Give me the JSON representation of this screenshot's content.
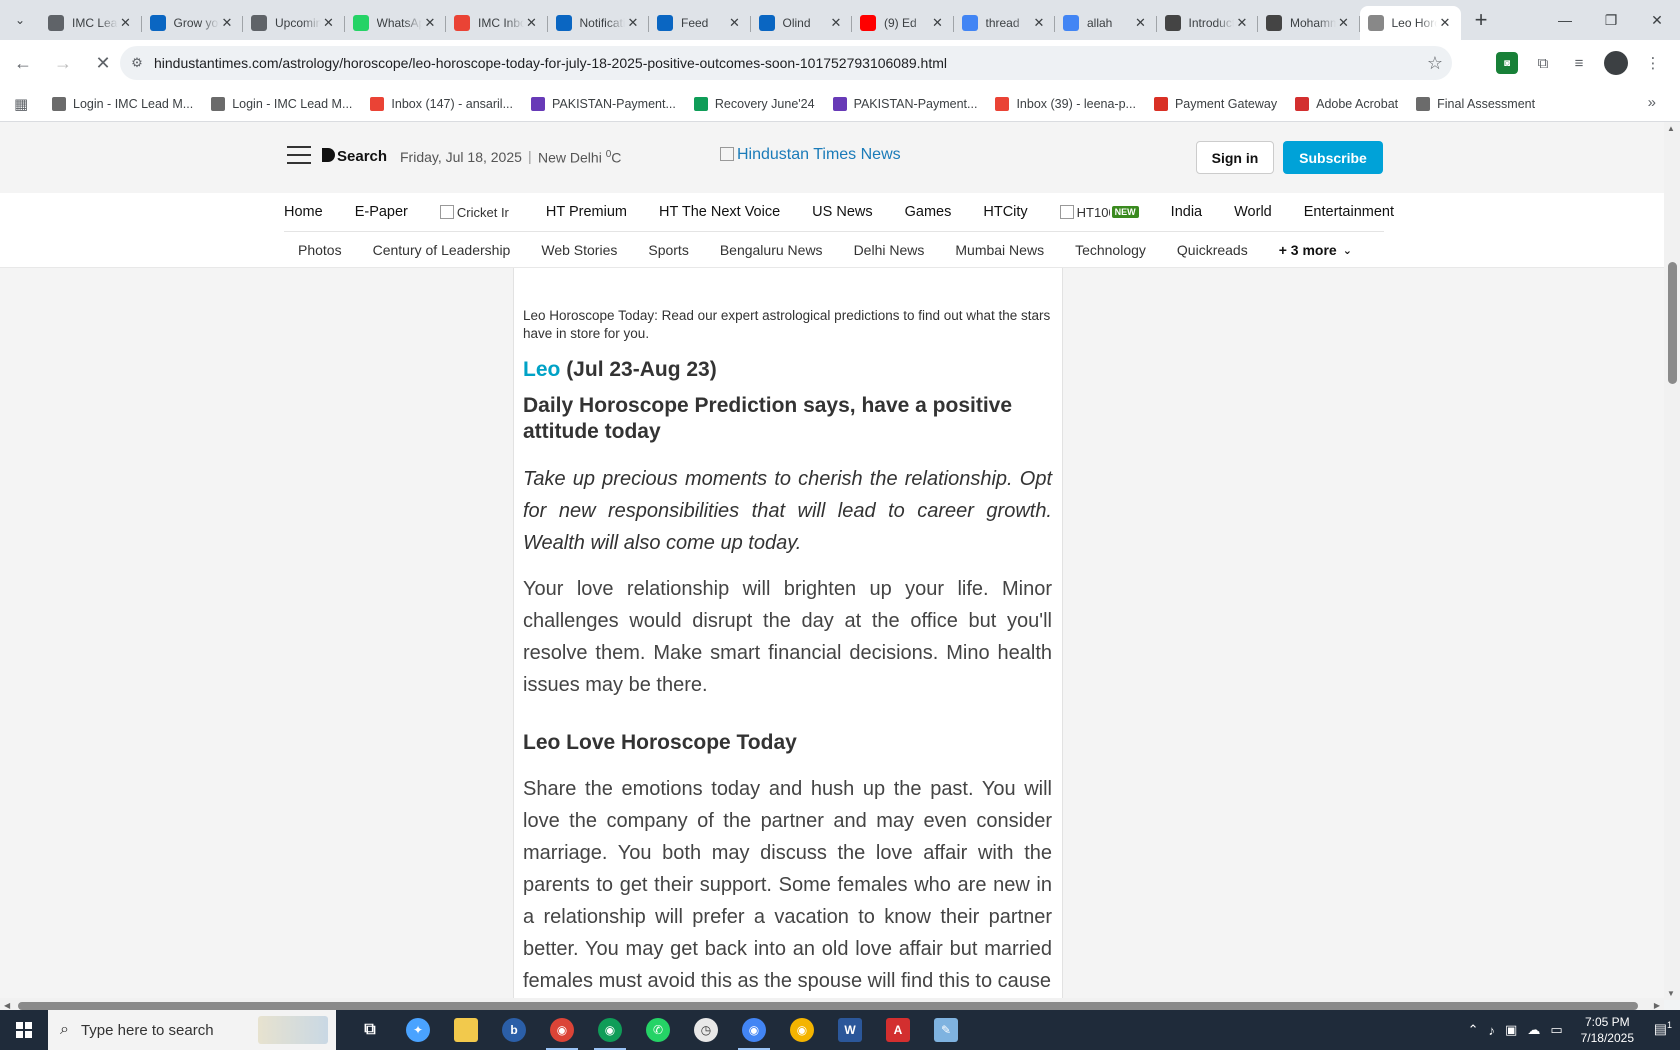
{
  "browser": {
    "tabs": [
      {
        "title": "IMC Lead Management",
        "icon": "imc-icon",
        "color": "#5f6368"
      },
      {
        "title": "Grow your network",
        "icon": "linkedin-icon",
        "color": "#0a66c2"
      },
      {
        "title": "Upcoming",
        "icon": "imc-icon",
        "color": "#5f6368"
      },
      {
        "title": "WhatsApp",
        "icon": "whatsapp-icon",
        "color": "#25d366"
      },
      {
        "title": "IMC Inbox",
        "icon": "gmail-icon",
        "color": "#ea4335"
      },
      {
        "title": "Notifications",
        "icon": "linkedin-icon",
        "color": "#0a66c2"
      },
      {
        "title": "Feed",
        "icon": "linkedin-icon",
        "color": "#0a66c2"
      },
      {
        "title": "Olind",
        "icon": "linkedin-icon",
        "color": "#0a66c2"
      },
      {
        "title": "(9) Ed",
        "icon": "youtube-icon",
        "color": "#ff0000"
      },
      {
        "title": "thread",
        "icon": "google-icon",
        "color": "#4285f4"
      },
      {
        "title": "allah",
        "icon": "google-icon",
        "color": "#4285f4"
      },
      {
        "title": "Introduction",
        "icon": "openai-icon",
        "color": "#444444"
      },
      {
        "title": "Mohammad",
        "icon": "openai-icon",
        "color": "#444444"
      },
      {
        "title": "Leo Horoscope",
        "icon": "loading-icon",
        "color": "#888888",
        "active": true
      }
    ],
    "url": "hindustantimes.com/astrology/horoscope/leo-horoscope-today-for-july-18-2025-positive-outcomes-soon-101752793106089.html",
    "bookmarks": [
      {
        "label": "Login - IMC Lead M...",
        "icon": "imc-icon",
        "color": "#6b6b6b"
      },
      {
        "label": "Login - IMC Lead M...",
        "icon": "imc-icon",
        "color": "#6b6b6b"
      },
      {
        "label": "Inbox (147) - ansaril...",
        "icon": "gmail-icon",
        "color": "#ea4335"
      },
      {
        "label": "PAKISTAN-Payment...",
        "icon": "forms-icon",
        "color": "#673ab7"
      },
      {
        "label": "Recovery June'24",
        "icon": "sheets-icon",
        "color": "#0f9d58"
      },
      {
        "label": "PAKISTAN-Payment...",
        "icon": "forms-icon",
        "color": "#673ab7"
      },
      {
        "label": "Inbox (39) - leena-p...",
        "icon": "gmail-icon",
        "color": "#ea4335"
      },
      {
        "label": "Payment Gateway",
        "icon": "gateway-icon",
        "color": "#d93025"
      },
      {
        "label": "Adobe Acrobat",
        "icon": "acrobat-icon",
        "color": "#d32f2f"
      },
      {
        "label": "Final Assessment",
        "icon": "imc-icon",
        "color": "#6b6b6b"
      }
    ]
  },
  "site": {
    "search_label": "Search",
    "date": "Friday, Jul 18, 2025",
    "city": "New Delhi",
    "unit": "0C",
    "logo_alt": "Hindustan Times News",
    "signin": "Sign in",
    "subscribe": "Subscribe",
    "nav_primary": [
      "Home",
      "E-Paper",
      "Cricket Ir",
      "HT Premium",
      "HT The Next Voice",
      "US News",
      "Games",
      "HTCity",
      "HT100",
      "India",
      "World",
      "Entertainment"
    ],
    "new_badge": "NEW",
    "nav_secondary": [
      "Photos",
      "Century of Leadership",
      "Web Stories",
      "Sports",
      "Bengaluru News",
      "Delhi News",
      "Mumbai News",
      "Technology",
      "Quickreads"
    ],
    "more_label": "+ 3 more"
  },
  "article": {
    "caption": "Leo Horoscope Today: Read our expert astrological predictions to find out what the stars have in store for you.",
    "sign": "Leo",
    "dates": "(Jul 23-Aug 23)",
    "prediction_head": "Daily Horoscope Prediction says, have a positive attitude today",
    "summary": "Take up precious moments to cherish the relationship. Opt for new responsibilities that will lead to career growth. Wealth will also come up today.",
    "body": "Your love relationship will brighten up your life. Minor challenges would disrupt the day at the office but you'll resolve them. Make smart financial decisions. Mino health issues may be there.",
    "love_head": "Leo Love Horoscope Today",
    "love_body": "Share the emotions today and hush up the past. You will love the company of the partner and may even consider marriage. You both may discuss the love affair with the parents to get their support. Some females who are new in a relationship will prefer a vacation to know their partner better. You may get back into an old love affair but married females must avoid this as the spouse will find this to cause"
  },
  "taskbar": {
    "search_placeholder": "Type here to search",
    "time": "7:05 PM",
    "date": "7/18/2025",
    "notification_count": "1"
  }
}
